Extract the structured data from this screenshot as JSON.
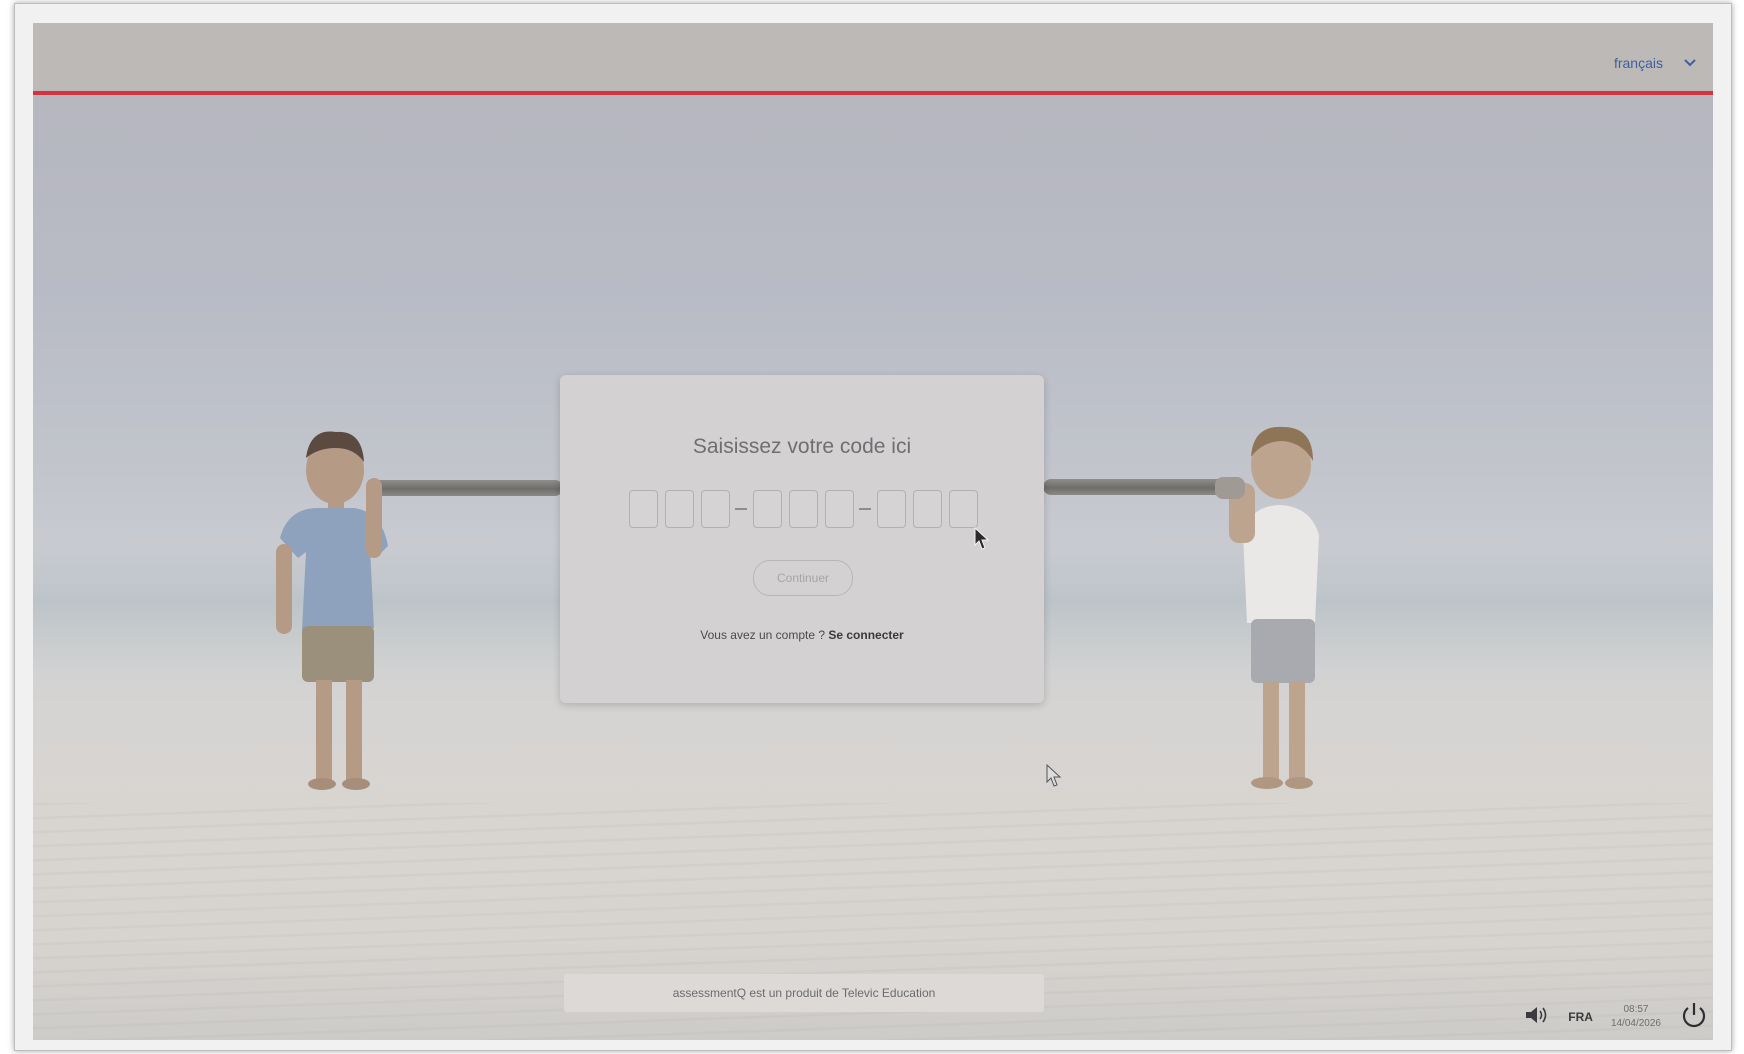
{
  "header": {
    "language_label": "français",
    "language_dropdown_icon": "chevron-down-icon"
  },
  "colors": {
    "accent_line": "#d4323c",
    "language_link": "#3e5fa0"
  },
  "login_card": {
    "title": "Saisissez votre code ici",
    "code_groups": [
      3,
      3,
      3
    ],
    "continue_label": "Continuer",
    "account_prompt": "Vous avez un compte ?",
    "login_link": "Se connecter"
  },
  "footer": {
    "product_note": "assessmentQ est un produit de Televic Education"
  },
  "taskbar": {
    "volume_icon": "speaker-icon",
    "keyboard_language": "FRA",
    "time": "08:57",
    "date": "14/04/2026",
    "power_icon": "power-icon"
  }
}
